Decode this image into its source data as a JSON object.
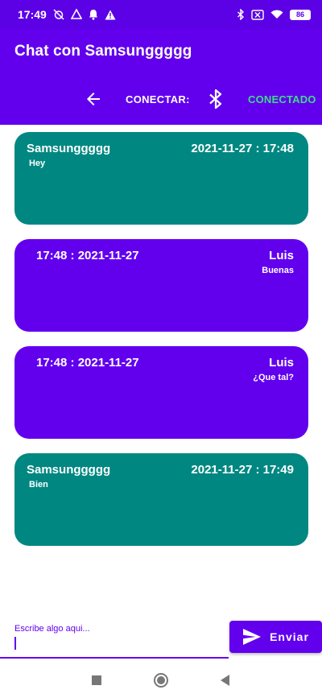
{
  "status_bar": {
    "time": "17:49",
    "battery": "86"
  },
  "app_bar": {
    "title": "Chat con Samsunggggg"
  },
  "connect_bar": {
    "label": "CONECTAR:",
    "status": "CONECTADO"
  },
  "messages": [
    {
      "type": "received",
      "sender": "Samsunggggg",
      "time": "2021-11-27 : 17:48",
      "text": "Hey"
    },
    {
      "type": "sent",
      "sender": "Luis",
      "time": "17:48 : 2021-11-27",
      "text": "Buenas"
    },
    {
      "type": "sent",
      "sender": "Luis",
      "time": "17:48 : 2021-11-27",
      "text": "¿Que tal?"
    },
    {
      "type": "received",
      "sender": "Samsunggggg",
      "time": "2021-11-27 : 17:49",
      "text": "Bien"
    }
  ],
  "input": {
    "placeholder": "Escribe algo aqui...",
    "value": ""
  },
  "send_button": {
    "label": "Enviar"
  },
  "colors": {
    "primary": "#6200ee",
    "received_bubble": "#008781",
    "connected": "#3ddc84"
  },
  "icons": [
    "back-arrow-icon",
    "bluetooth-icon",
    "send-icon"
  ]
}
